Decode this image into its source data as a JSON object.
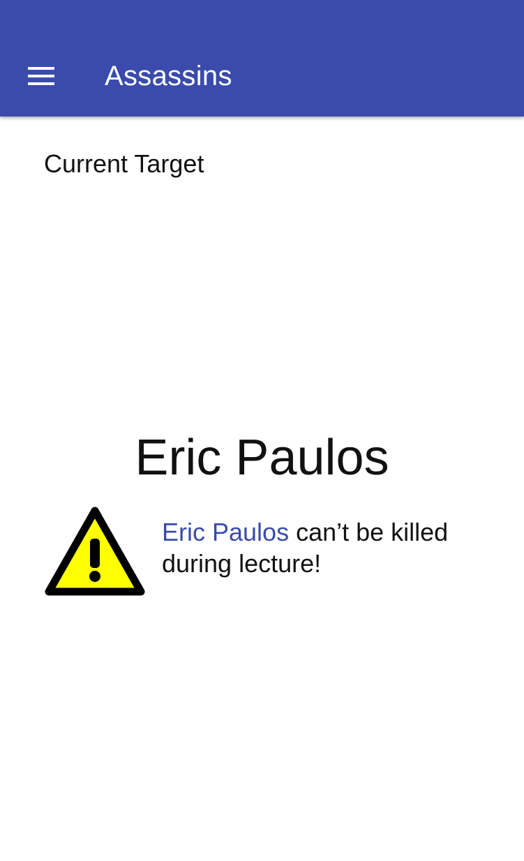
{
  "colors": {
    "app_bar": "#3a4bab",
    "accent": "#3a4bab",
    "warning_fill": "#ffff00",
    "text": "#111111"
  },
  "app_bar": {
    "title": "Assassins",
    "menu_icon": "hamburger-menu-icon"
  },
  "main": {
    "section_label": "Current Target",
    "target_name": "Eric Paulos",
    "warning": {
      "icon": "warning-triangle-icon",
      "name_text": "Eric Paulos",
      "message": " can’t be killed during lecture!"
    }
  }
}
